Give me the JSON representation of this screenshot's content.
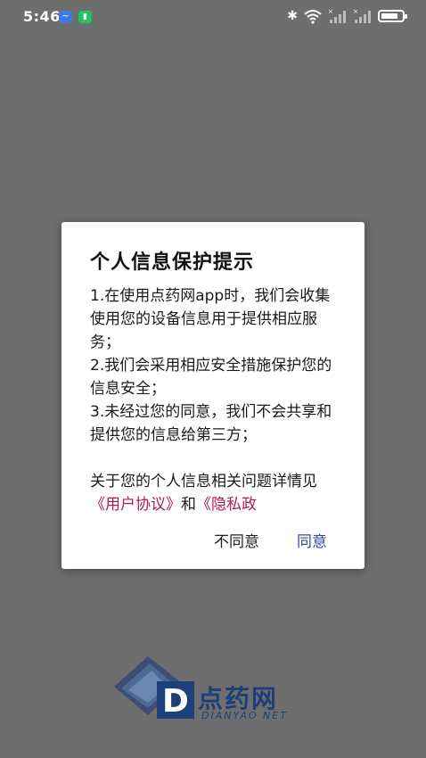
{
  "status_bar": {
    "time": "5:46",
    "notification_icons": [
      "messenger-icon",
      "app-notification-icon"
    ],
    "right_icons": [
      "bluetooth-icon",
      "wifi-icon",
      "signal-icon",
      "signal-icon",
      "battery-icon"
    ]
  },
  "dialog": {
    "title": "个人信息保护提示",
    "item1": "1.在使用点药网app时，我们会收集使用您的设备信息用于提供相应服务；",
    "item2": "2.我们会采用相应安全措施保护您的信息安全；",
    "item3": "3.未经过您的同意，我们不会共享和提供您的信息给第三方；",
    "footer_prefix": "关于您的个人信息相关问题详情见",
    "user_agreement_link": "《用户协议》",
    "and_text": "和",
    "privacy_link": "《隐私政",
    "disagree_label": "不同意",
    "agree_label": "同意"
  },
  "logo": {
    "name": "点药网",
    "subtitle": "DIANYAO NET",
    "letter": "D"
  },
  "colors": {
    "overlay": "#6e6e6e",
    "link": "#b0185a",
    "agree": "#2c4f8f",
    "brand": "#1d3f7a"
  }
}
